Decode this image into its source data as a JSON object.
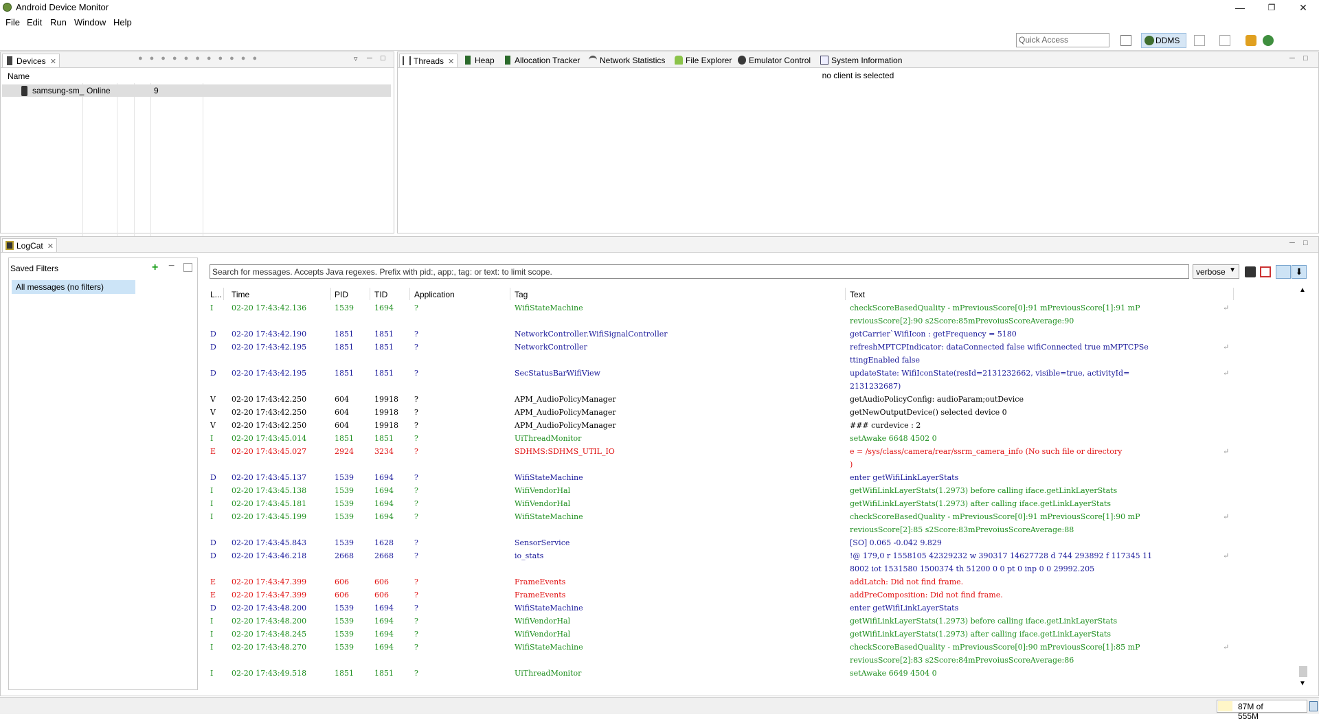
{
  "window": {
    "title": "Android Device Monitor"
  },
  "menu": [
    "File",
    "Edit",
    "Run",
    "Window",
    "Help"
  ],
  "toolbar": {
    "quick_access_placeholder": "Quick Access",
    "perspective": "DDMS"
  },
  "devices": {
    "tab": "Devices",
    "column_name": "Name",
    "rows": [
      {
        "name": "samsung-sm_",
        "state": "Online",
        "port": "9"
      }
    ]
  },
  "tools": {
    "tabs": [
      "Threads",
      "Heap",
      "Allocation Tracker",
      "Network Statistics",
      "File Explorer",
      "Emulator Control",
      "System Information"
    ],
    "message": "no client is selected"
  },
  "logcat": {
    "tab": "LogCat",
    "saved_filters_title": "Saved Filters",
    "filter_selected": "All messages (no filters)",
    "search_placeholder": "Search for messages. Accepts Java regexes. Prefix with pid:, app:, tag: or text: to limit scope.",
    "level_select": "verbose",
    "columns": {
      "level": "L...",
      "time": "Time",
      "pid": "PID",
      "tid": "TID",
      "app": "Application",
      "tag": "Tag",
      "text": "Text"
    },
    "rows": [
      {
        "l": "I",
        "time": "02-20 17:43:42.136",
        "pid": "1539",
        "tid": "1694",
        "app": "?",
        "tag": "WifiStateMachine",
        "text": "checkScoreBasedQuality -  mPreviousScore[0]:91 mPreviousScore[1]:91 mP",
        "wrap": "reviousScore[2]:90 s2Score:85mPrevoiusScoreAverage:90"
      },
      {
        "l": "D",
        "time": "02-20 17:43:42.190",
        "pid": "1851",
        "tid": "1851",
        "app": "?",
        "tag": "NetworkController.WifiSignalController",
        "text": "getCarrier`WifiIcon : getFrequency = 5180",
        "wrap": ""
      },
      {
        "l": "D",
        "time": "02-20 17:43:42.195",
        "pid": "1851",
        "tid": "1851",
        "app": "?",
        "tag": "NetworkController",
        "text": "refreshMPTCPIndicator: dataConnected false wifiConnected true mMPTCPSe",
        "wrap": "ttingEnabled false"
      },
      {
        "l": "D",
        "time": "02-20 17:43:42.195",
        "pid": "1851",
        "tid": "1851",
        "app": "?",
        "tag": "SecStatusBarWifiView",
        "text": "updateState: WifiIconState(resId=2131232662, visible=true, activityId=",
        "wrap": "2131232687)"
      },
      {
        "l": "V",
        "time": "02-20 17:43:42.250",
        "pid": "604",
        "tid": "19918",
        "app": "?",
        "tag": "APM_AudioPolicyManager",
        "text": "getAudioPolicyConfig: audioParam;outDevice",
        "wrap": ""
      },
      {
        "l": "V",
        "time": "02-20 17:43:42.250",
        "pid": "604",
        "tid": "19918",
        "app": "?",
        "tag": "APM_AudioPolicyManager",
        "text": "getNewOutputDevice() selected device 0",
        "wrap": ""
      },
      {
        "l": "V",
        "time": "02-20 17:43:42.250",
        "pid": "604",
        "tid": "19918",
        "app": "?",
        "tag": "APM_AudioPolicyManager",
        "text": "### curdevice : 2",
        "wrap": ""
      },
      {
        "l": "I",
        "time": "02-20 17:43:45.014",
        "pid": "1851",
        "tid": "1851",
        "app": "?",
        "tag": "UiThreadMonitor",
        "text": "setAwake 6648 4502 0",
        "wrap": ""
      },
      {
        "l": "E",
        "time": "02-20 17:43:45.027",
        "pid": "2924",
        "tid": "3234",
        "app": "?",
        "tag": "SDHMS:SDHMS_UTIL_IO",
        "text": "e = /sys/class/camera/rear/ssrm_camera_info (No such file or directory",
        "wrap": ")"
      },
      {
        "l": "D",
        "time": "02-20 17:43:45.137",
        "pid": "1539",
        "tid": "1694",
        "app": "?",
        "tag": "WifiStateMachine",
        "text": "enter getWifiLinkLayerStats",
        "wrap": ""
      },
      {
        "l": "I",
        "time": "02-20 17:43:45.138",
        "pid": "1539",
        "tid": "1694",
        "app": "?",
        "tag": "WifiVendorHal",
        "text": "getWifiLinkLayerStats(1.2973) before calling iface.getLinkLayerStats",
        "wrap": ""
      },
      {
        "l": "I",
        "time": "02-20 17:43:45.181",
        "pid": "1539",
        "tid": "1694",
        "app": "?",
        "tag": "WifiVendorHal",
        "text": "getWifiLinkLayerStats(1.2973) after calling iface.getLinkLayerStats",
        "wrap": ""
      },
      {
        "l": "I",
        "time": "02-20 17:43:45.199",
        "pid": "1539",
        "tid": "1694",
        "app": "?",
        "tag": "WifiStateMachine",
        "text": "checkScoreBasedQuality -  mPreviousScore[0]:91 mPreviousScore[1]:90 mP",
        "wrap": "reviousScore[2]:85 s2Score:83mPrevoiusScoreAverage:88"
      },
      {
        "l": "D",
        "time": "02-20 17:43:45.843",
        "pid": "1539",
        "tid": "1628",
        "app": "?",
        "tag": "SensorService",
        "text": "[SO] 0.065 -0.042 9.829",
        "wrap": ""
      },
      {
        "l": "D",
        "time": "02-20 17:43:46.218",
        "pid": "2668",
        "tid": "2668",
        "app": "?",
        "tag": "io_stats",
        "text": "!@ 179,0 r 1558105 42329232 w 390317 14627728 d 744 293892 f 117345 11",
        "wrap": "8002 iot 1531580 1500374 th 51200 0 0 pt 0 inp 0 0 29992.205"
      },
      {
        "l": "E",
        "time": "02-20 17:43:47.399",
        "pid": "606",
        "tid": "606",
        "app": "?",
        "tag": "FrameEvents",
        "text": "addLatch: Did not find frame.",
        "wrap": ""
      },
      {
        "l": "E",
        "time": "02-20 17:43:47.399",
        "pid": "606",
        "tid": "606",
        "app": "?",
        "tag": "FrameEvents",
        "text": "addPreComposition: Did not find frame.",
        "wrap": ""
      },
      {
        "l": "D",
        "time": "02-20 17:43:48.200",
        "pid": "1539",
        "tid": "1694",
        "app": "?",
        "tag": "WifiStateMachine",
        "text": "enter getWifiLinkLayerStats",
        "wrap": ""
      },
      {
        "l": "I",
        "time": "02-20 17:43:48.200",
        "pid": "1539",
        "tid": "1694",
        "app": "?",
        "tag": "WifiVendorHal",
        "text": "getWifiLinkLayerStats(1.2973) before calling iface.getLinkLayerStats",
        "wrap": ""
      },
      {
        "l": "I",
        "time": "02-20 17:43:48.245",
        "pid": "1539",
        "tid": "1694",
        "app": "?",
        "tag": "WifiVendorHal",
        "text": "getWifiLinkLayerStats(1.2973) after calling iface.getLinkLayerStats",
        "wrap": ""
      },
      {
        "l": "I",
        "time": "02-20 17:43:48.270",
        "pid": "1539",
        "tid": "1694",
        "app": "?",
        "tag": "WifiStateMachine",
        "text": "checkScoreBasedQuality -  mPreviousScore[0]:90 mPreviousScore[1]:85 mP",
        "wrap": "reviousScore[2]:83 s2Score:84mPrevoiusScoreAverage:86"
      },
      {
        "l": "I",
        "time": "02-20 17:43:49.518",
        "pid": "1851",
        "tid": "1851",
        "app": "?",
        "tag": "UiThreadMonitor",
        "text": "setAwake 6649 4504 0",
        "wrap": ""
      }
    ]
  },
  "status": {
    "memory": "87M of 555M",
    "memory_used_fraction": 0.16
  },
  "colors": {
    "info": "#1f8f1f",
    "debug": "#1a1a9a",
    "verbose": "#000000",
    "error": "#e01010",
    "selection": "#cce4f7"
  }
}
